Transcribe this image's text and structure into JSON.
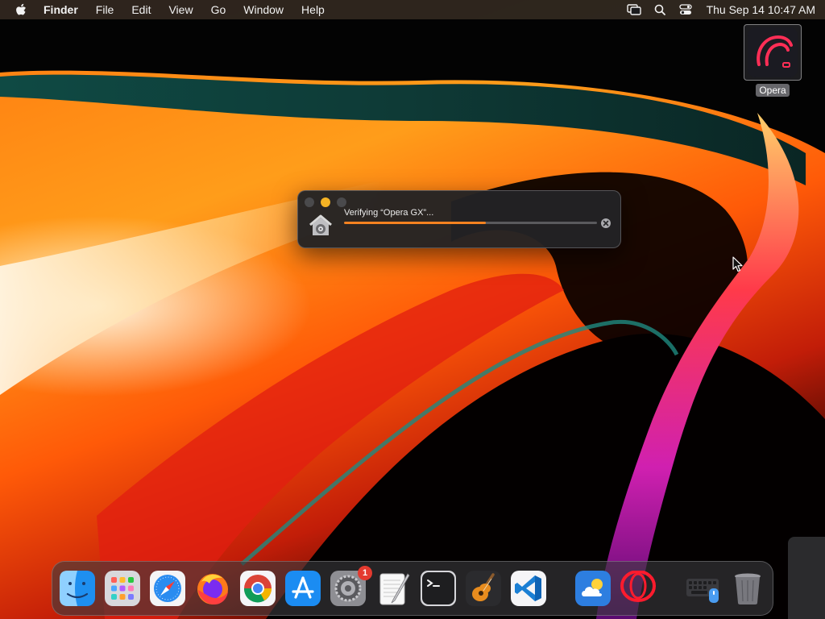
{
  "menubar": {
    "apple_icon": "apple-logo-icon",
    "app_name": "Finder",
    "menus": [
      "File",
      "Edit",
      "View",
      "Go",
      "Window"
    ],
    "help": "Help",
    "status_icons": [
      "screen-mirroring-icon",
      "spotlight-search-icon",
      "control-center-icon"
    ],
    "clock": "Thu Sep 14  10:47 AM"
  },
  "desktop": {
    "icon_label": "Opera",
    "icon": "opera-gx-installer-icon"
  },
  "progress_panel": {
    "title": "Verifying “Opera GX”...",
    "progress": 0.56,
    "accent": "#f58220",
    "app_icon": "installer-house-icon",
    "stop_icon": "stop-x-icon"
  },
  "dock": {
    "apps": [
      {
        "name": "Finder",
        "icon": "finder-icon",
        "running": true
      },
      {
        "name": "Launchpad",
        "icon": "launchpad-icon",
        "running": false
      },
      {
        "name": "Safari",
        "icon": "safari-icon",
        "running": false
      },
      {
        "name": "Firefox",
        "icon": "firefox-icon",
        "running": true
      },
      {
        "name": "Chrome",
        "icon": "chrome-icon",
        "running": false
      },
      {
        "name": "App Store",
        "icon": "app-store-icon",
        "running": false
      },
      {
        "name": "System Settings",
        "icon": "system-settings-icon",
        "running": false,
        "badge": "1"
      },
      {
        "name": "TextEdit",
        "icon": "textedit-icon",
        "running": false
      },
      {
        "name": "Terminal",
        "icon": "terminal-icon",
        "running": true
      },
      {
        "name": "GarageBand",
        "icon": "garageband-icon",
        "running": false
      },
      {
        "name": "VS Code",
        "icon": "vscode-icon",
        "running": false
      }
    ],
    "recents": [
      {
        "name": "Weather",
        "icon": "weather-icon"
      },
      {
        "name": "Opera",
        "icon": "opera-icon"
      }
    ],
    "utilities": [
      {
        "name": "Keyboard Viewer",
        "icon": "keyboard-viewer-icon"
      },
      {
        "name": "Trash",
        "icon": "trash-icon"
      }
    ]
  }
}
